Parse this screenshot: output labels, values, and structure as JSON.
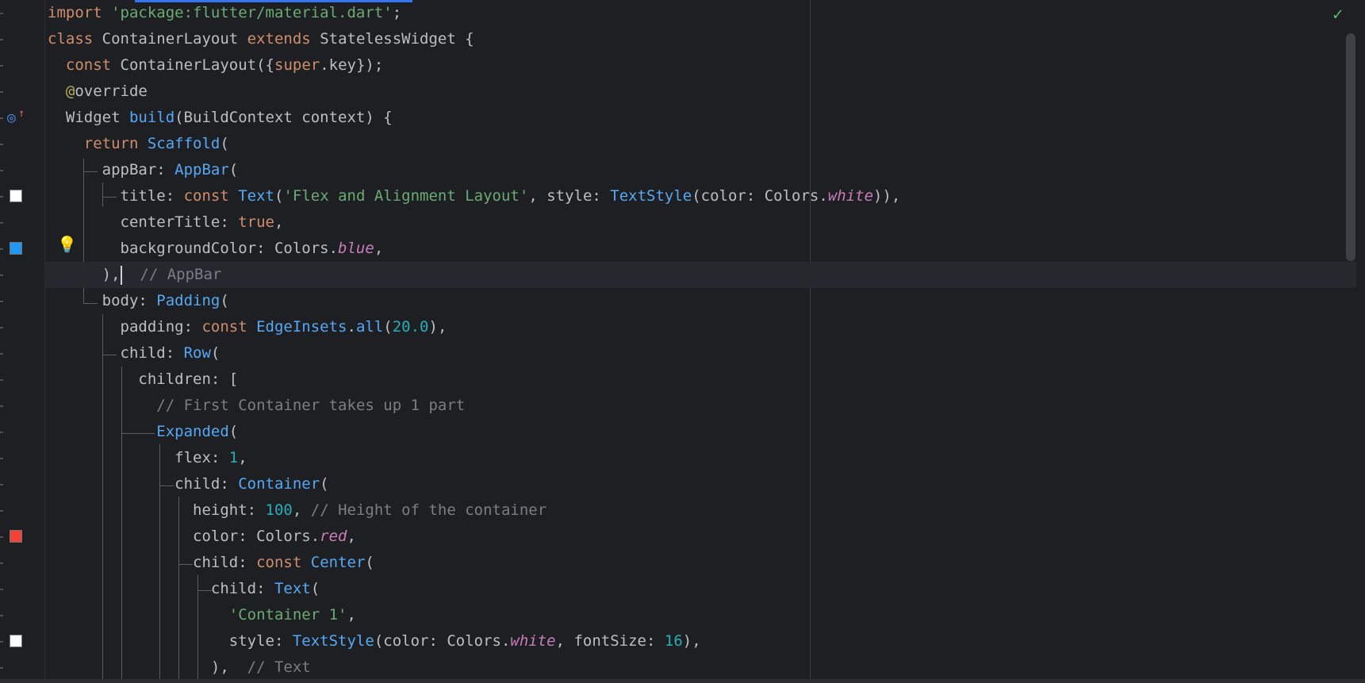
{
  "editor": {
    "status": {
      "inspection_icon": "check-icon"
    },
    "lines": [
      [
        {
          "t": "import ",
          "c": "kw"
        },
        {
          "t": "'package:flutter/material.dart'",
          "c": "str"
        },
        {
          "t": ";",
          "c": "plain"
        }
      ],
      [
        {
          "t": "class ",
          "c": "kw"
        },
        {
          "t": "ContainerLayout ",
          "c": "plain"
        },
        {
          "t": "extends ",
          "c": "kw"
        },
        {
          "t": "StatelessWidget {",
          "c": "plain"
        }
      ],
      [
        {
          "t": "  ",
          "c": "plain"
        },
        {
          "t": "const ",
          "c": "kw"
        },
        {
          "t": "ContainerLayout({",
          "c": "plain"
        },
        {
          "t": "super",
          "c": "kw"
        },
        {
          "t": ".key});",
          "c": "plain"
        }
      ],
      [
        {
          "t": "  ",
          "c": "plain"
        },
        {
          "t": "@",
          "c": "ann"
        },
        {
          "t": "override",
          "c": "plain"
        }
      ],
      [
        {
          "t": "  Widget ",
          "c": "plain"
        },
        {
          "t": "build",
          "c": "cls"
        },
        {
          "t": "(BuildContext context) {",
          "c": "plain"
        }
      ],
      [
        {
          "t": "    ",
          "c": "plain"
        },
        {
          "t": "return ",
          "c": "kw"
        },
        {
          "t": "Scaffold",
          "c": "cls"
        },
        {
          "t": "(",
          "c": "plain"
        }
      ],
      [
        {
          "t": "      appBar: ",
          "c": "plain"
        },
        {
          "t": "AppBar",
          "c": "cls"
        },
        {
          "t": "(",
          "c": "plain"
        }
      ],
      [
        {
          "t": "        title: ",
          "c": "plain"
        },
        {
          "t": "const ",
          "c": "kw"
        },
        {
          "t": "Text",
          "c": "cls"
        },
        {
          "t": "(",
          "c": "plain"
        },
        {
          "t": "'Flex and Alignment Layout'",
          "c": "str"
        },
        {
          "t": ", style: ",
          "c": "plain"
        },
        {
          "t": "TextStyle",
          "c": "cls"
        },
        {
          "t": "(color: Colors.",
          "c": "plain"
        },
        {
          "t": "white",
          "c": "ital"
        },
        {
          "t": ")),",
          "c": "plain"
        }
      ],
      [
        {
          "t": "        centerTitle: ",
          "c": "plain"
        },
        {
          "t": "true",
          "c": "kw"
        },
        {
          "t": ",",
          "c": "plain"
        }
      ],
      [
        {
          "t": "        backgroundColor: Colors.",
          "c": "plain"
        },
        {
          "t": "blue",
          "c": "ital"
        },
        {
          "t": ",",
          "c": "plain"
        }
      ],
      [
        {
          "t": "      ),",
          "c": "plain"
        },
        {
          "t": "CARET",
          "c": "caret"
        },
        {
          "t": "  // AppBar",
          "c": "cmt"
        }
      ],
      [
        {
          "t": "      body: ",
          "c": "plain"
        },
        {
          "t": "Padding",
          "c": "cls"
        },
        {
          "t": "(",
          "c": "plain"
        }
      ],
      [
        {
          "t": "        padding: ",
          "c": "plain"
        },
        {
          "t": "const ",
          "c": "kw"
        },
        {
          "t": "EdgeInsets",
          "c": "cls"
        },
        {
          "t": ".",
          "c": "plain"
        },
        {
          "t": "all",
          "c": "cls"
        },
        {
          "t": "(",
          "c": "plain"
        },
        {
          "t": "20.0",
          "c": "num"
        },
        {
          "t": "),",
          "c": "plain"
        }
      ],
      [
        {
          "t": "        child: ",
          "c": "plain"
        },
        {
          "t": "Row",
          "c": "cls"
        },
        {
          "t": "(",
          "c": "plain"
        }
      ],
      [
        {
          "t": "          children: [",
          "c": "plain"
        }
      ],
      [
        {
          "t": "            ",
          "c": "plain"
        },
        {
          "t": "// First Container takes up 1 part",
          "c": "cmt"
        }
      ],
      [
        {
          "t": "            ",
          "c": "plain"
        },
        {
          "t": "Expanded",
          "c": "cls"
        },
        {
          "t": "(",
          "c": "plain"
        }
      ],
      [
        {
          "t": "              flex: ",
          "c": "plain"
        },
        {
          "t": "1",
          "c": "num"
        },
        {
          "t": ",",
          "c": "plain"
        }
      ],
      [
        {
          "t": "              child: ",
          "c": "plain"
        },
        {
          "t": "Container",
          "c": "cls"
        },
        {
          "t": "(",
          "c": "plain"
        }
      ],
      [
        {
          "t": "                height: ",
          "c": "plain"
        },
        {
          "t": "100",
          "c": "num"
        },
        {
          "t": ", ",
          "c": "plain"
        },
        {
          "t": "// Height of the container",
          "c": "cmt"
        }
      ],
      [
        {
          "t": "                color: Colors.",
          "c": "plain"
        },
        {
          "t": "red",
          "c": "ital"
        },
        {
          "t": ",",
          "c": "plain"
        }
      ],
      [
        {
          "t": "                child: ",
          "c": "plain"
        },
        {
          "t": "const ",
          "c": "kw"
        },
        {
          "t": "Center",
          "c": "cls"
        },
        {
          "t": "(",
          "c": "plain"
        }
      ],
      [
        {
          "t": "                  child: ",
          "c": "plain"
        },
        {
          "t": "Text",
          "c": "cls"
        },
        {
          "t": "(",
          "c": "plain"
        }
      ],
      [
        {
          "t": "                    ",
          "c": "plain"
        },
        {
          "t": "'Container 1'",
          "c": "str"
        },
        {
          "t": ",",
          "c": "plain"
        }
      ],
      [
        {
          "t": "                    style: ",
          "c": "plain"
        },
        {
          "t": "TextStyle",
          "c": "cls"
        },
        {
          "t": "(color: Colors.",
          "c": "plain"
        },
        {
          "t": "white",
          "c": "ital"
        },
        {
          "t": ", fontSize: ",
          "c": "plain"
        },
        {
          "t": "16",
          "c": "num"
        },
        {
          "t": "),",
          "c": "plain"
        }
      ],
      [
        {
          "t": "                  ),  ",
          "c": "plain"
        },
        {
          "t": "// Text",
          "c": "cmt"
        }
      ]
    ],
    "current_line": 10,
    "gutter_swatches": [
      {
        "line": 7,
        "color": "#ffffff"
      },
      {
        "line": 9,
        "color": "#2196f3"
      },
      {
        "line": 20,
        "color": "#f44336"
      },
      {
        "line": 24,
        "color": "#ffffff"
      }
    ],
    "gutter_icons": {
      "override": "override-icon",
      "bulb": "lightbulb-icon"
    }
  }
}
